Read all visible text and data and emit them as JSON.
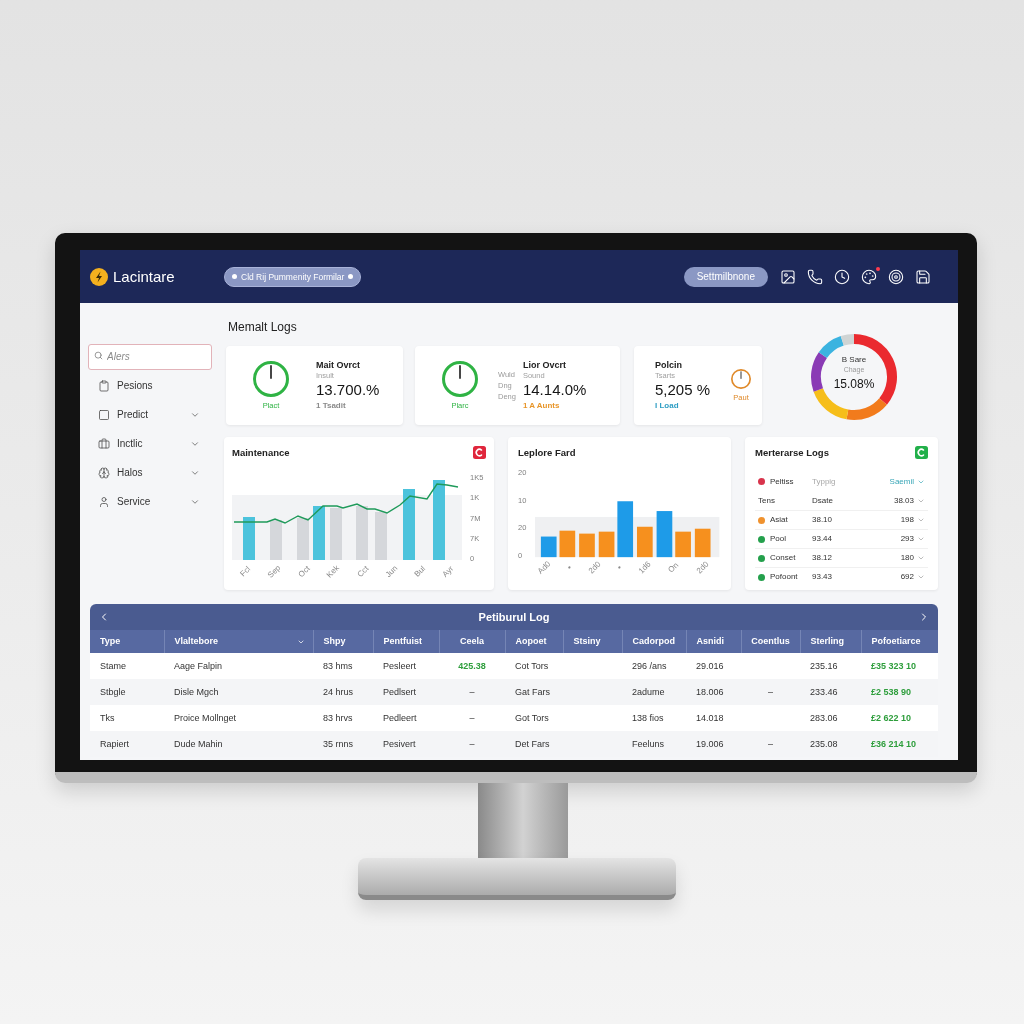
{
  "header": {
    "logo": "Lacintare",
    "workspace": "Cld Rij Pummenity Formilar",
    "action": "Settmilbnone",
    "icons": [
      {
        "badge": false
      },
      {
        "badge": false
      },
      {
        "badge": false
      },
      {
        "badge": true
      },
      {
        "badge": false
      },
      {
        "badge": false
      }
    ]
  },
  "sidebar": {
    "search": {
      "placeholder": "Alers"
    },
    "items": [
      {
        "label": "Pesions",
        "expandable": false
      },
      {
        "label": "Predict",
        "expandable": true
      },
      {
        "label": "Inctlic",
        "expandable": true
      },
      {
        "label": "Halos",
        "expandable": true
      },
      {
        "label": "Service",
        "expandable": true
      }
    ]
  },
  "page_title": "Memalt Logs",
  "kpis": [
    {
      "kind": "gauge_left",
      "title": "Mait Ovrct",
      "subtitle": "Insult",
      "value": "13.700.%",
      "note": {
        "text": "1 Tsadit",
        "color": "#8a8a8a"
      },
      "gauge": {
        "label": "Plact",
        "color": "#2fb344"
      }
    },
    {
      "kind": "gauge_left",
      "side_labels": [
        "Wuld",
        "Dng",
        "Deng"
      ],
      "title": "Lior Ovcrt",
      "subtitle": "Sound",
      "value": "14.14.0%",
      "note": {
        "text": "1 A Aunts",
        "color": "#e8962a"
      },
      "gauge": {
        "label": "Plarc",
        "color": "#2fb344"
      }
    },
    {
      "kind": "gauge_right",
      "title": "Polcin",
      "subtitle": "Tsarts",
      "value": "5,205 %",
      "note": {
        "text": "I Load",
        "color": "#2f9ec4"
      },
      "gauge": {
        "label": "Paut",
        "color": "#e08a2a"
      }
    }
  ],
  "donut": {
    "title": "B Sare",
    "caption": "Chage",
    "value": "15.08%"
  },
  "panels": [
    {
      "kind": "combo_chart",
      "title": "Maintenance",
      "color": "#e0263c",
      "y_labels": [
        "1K5",
        "1K",
        "7M",
        "7K",
        "0"
      ],
      "x_labels": [
        "Fcl",
        "Sep",
        "Oct",
        "Kek",
        "Cct",
        "Jun",
        "Bul",
        "Ayr"
      ]
    },
    {
      "kind": "bar_chart",
      "title": "Leplore Fard",
      "y_labels": [
        "20",
        "10",
        "20",
        "0"
      ],
      "x_labels": [
        "Ad0",
        "•",
        "2d0",
        "•",
        "1d6",
        "On",
        "2d0"
      ]
    },
    {
      "kind": "list",
      "title": "Merterarse Logs",
      "color": "#22b04a",
      "rows": [
        {
          "kind": "filter",
          "color": "#d8344c",
          "cells": [
            "Peltiss",
            "Typpig",
            "Saemil"
          ]
        },
        {
          "kind": "heading",
          "cells": [
            "Tens",
            "Dsate",
            "38.03"
          ]
        },
        {
          "kind": "item",
          "color": "#f0922e",
          "cells": [
            "Asiat",
            "38.10",
            "198"
          ]
        },
        {
          "kind": "item",
          "color": "#24a04c",
          "cells": [
            "Pool",
            "93.44",
            "293"
          ]
        },
        {
          "kind": "item",
          "color": "#24a04c",
          "cells": [
            "Conset",
            "38.12",
            "180"
          ]
        },
        {
          "kind": "item",
          "color": "#24a04c",
          "cells": [
            "Pofoont",
            "93.43",
            "692"
          ]
        }
      ]
    }
  ],
  "table": {
    "title": "Petiburul Log",
    "columns": [
      {
        "label": "Type",
        "menu": false
      },
      {
        "label": "Vlaltebore",
        "menu": true
      },
      {
        "label": "Shpy",
        "menu": false
      },
      {
        "label": "Pentfuist",
        "menu": false
      },
      {
        "label": "Ceela",
        "menu": false
      },
      {
        "label": "Aopoet",
        "menu": false
      },
      {
        "label": "Stsiny",
        "menu": false
      },
      {
        "label": "Cadorpod",
        "menu": false
      },
      {
        "label": "Asnidi",
        "menu": false
      },
      {
        "label": "Coentlus",
        "menu": false
      },
      {
        "label": "Sterling",
        "menu": false
      },
      {
        "label": "Pofoetiarce",
        "menu": false
      }
    ],
    "rows": [
      {
        "cells": [
          {
            "text": "Stame"
          },
          {
            "text": "Aage Falpin"
          },
          {
            "text": "83 hms"
          },
          {
            "text": "Pesleert"
          },
          {
            "text": "425.38",
            "color": "#2e9e3c"
          },
          {
            "text": "Cot Tors"
          },
          null,
          {
            "text": "296 /ans"
          },
          {
            "text": "29.016"
          },
          null,
          {
            "text": "235.16"
          },
          {
            "text": "£35 323 10",
            "color": "#2e9e3c"
          }
        ]
      },
      {
        "cells": [
          {
            "text": "Stbgle"
          },
          {
            "text": "Disle Mgch"
          },
          {
            "text": "24 hrus"
          },
          {
            "text": "Pedlsert"
          },
          {
            "text": "–"
          },
          {
            "text": "Gat Fars"
          },
          null,
          {
            "text": "2adume"
          },
          {
            "text": "18.006"
          },
          {
            "text": "–"
          },
          {
            "text": "233.46"
          },
          {
            "text": "£2 538 90",
            "color": "#2e9e3c"
          }
        ]
      },
      {
        "cells": [
          {
            "text": "Tks"
          },
          {
            "text": "Proice Mollnget"
          },
          {
            "text": "83 hrvs"
          },
          {
            "text": "Pedleert"
          },
          {
            "text": "–"
          },
          {
            "text": "Got Tors"
          },
          null,
          {
            "text": "138 fios"
          },
          {
            "text": "14.018"
          },
          null,
          {
            "text": "283.06"
          },
          {
            "text": "£2 622 10",
            "color": "#2e9e3c"
          }
        ]
      },
      {
        "cells": [
          {
            "text": "Rapiert"
          },
          {
            "text": "Dude Mahin"
          },
          {
            "text": "35 rnns"
          },
          {
            "text": "Pesivert"
          },
          {
            "text": "–"
          },
          {
            "text": "Det Fars"
          },
          null,
          {
            "text": "Feeluns"
          },
          {
            "text": "19.006"
          },
          {
            "text": "–"
          },
          {
            "text": "235.08"
          },
          {
            "text": "£36 214 10",
            "color": "#2e9e3c"
          }
        ]
      }
    ]
  }
}
